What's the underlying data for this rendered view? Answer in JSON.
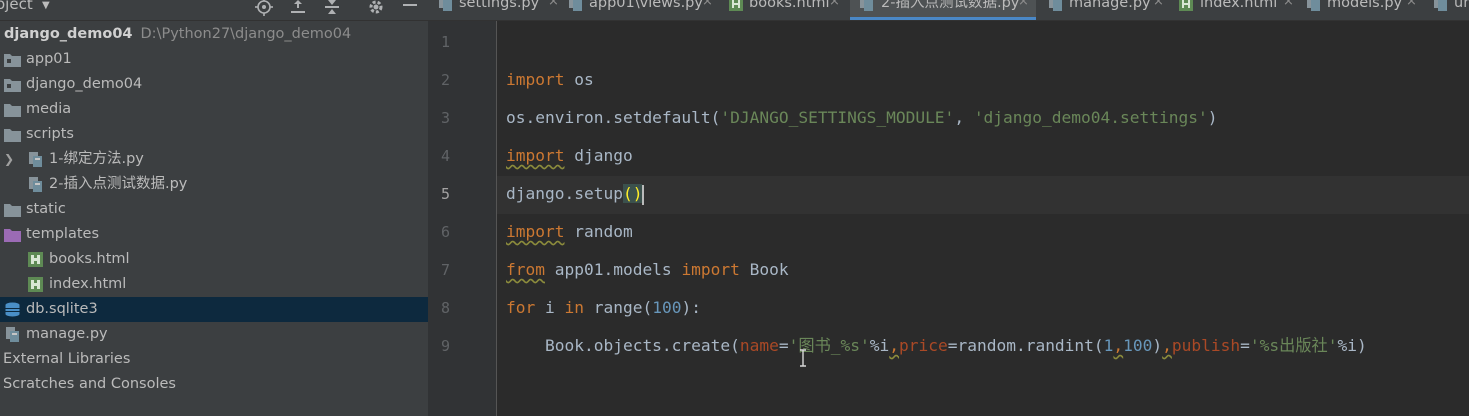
{
  "project_panel": {
    "title": "oject",
    "root": {
      "name": "django_demo04",
      "path": "D:\\Python27\\django_demo04"
    },
    "items": [
      {
        "label": "app01",
        "icon": "folder-icon"
      },
      {
        "label": "django_demo04",
        "icon": "folder-icon"
      },
      {
        "label": "media",
        "icon": "folder-icon"
      },
      {
        "label": "scripts",
        "icon": "folder-icon"
      },
      {
        "label": "1-绑定方法.py",
        "icon": "python-file-icon"
      },
      {
        "label": "2-插入点测试数据.py",
        "icon": "python-file-icon"
      },
      {
        "label": "static",
        "icon": "folder-icon"
      },
      {
        "label": "templates",
        "icon": "templates-folder-icon"
      },
      {
        "label": "books.html",
        "icon": "html-file-icon"
      },
      {
        "label": "index.html",
        "icon": "html-file-icon"
      },
      {
        "label": "db.sqlite3",
        "icon": "database-icon",
        "selected": true
      },
      {
        "label": "manage.py",
        "icon": "python-file-icon"
      },
      {
        "label": "External Libraries",
        "icon": ""
      },
      {
        "label": "Scratches and Consoles",
        "icon": ""
      }
    ]
  },
  "tabs": [
    {
      "label": "settings.py",
      "icon": "python-file-icon"
    },
    {
      "label": "app01\\views.py",
      "icon": "python-file-icon"
    },
    {
      "label": "books.html",
      "icon": "html-file-icon"
    },
    {
      "label": "2-插入点测试数据.py",
      "icon": "python-file-icon",
      "active": true
    },
    {
      "label": "manage.py",
      "icon": "python-file-icon"
    },
    {
      "label": "index.html",
      "icon": "html-file-icon"
    },
    {
      "label": "models.py",
      "icon": "python-file-icon"
    },
    {
      "label": "url",
      "icon": "python-file-icon"
    }
  ],
  "tab_close_glyph": "×",
  "editor": {
    "line_numbers": [
      "1",
      "2",
      "3",
      "4",
      "5",
      "6",
      "7",
      "8",
      "9"
    ],
    "current_line": 5,
    "code": {
      "l2_kw": "import",
      "l2_rest": " os",
      "l3_a": "os.environ.setdefault(",
      "l3_s1": "'DJANGO_SETTINGS_MODULE'",
      "l3_b": ", ",
      "l3_s2": "'django_demo04.settings'",
      "l3_c": ")",
      "l4_kw": "import",
      "l4_rest": " django",
      "l5_a": "django.setup",
      "l5_paren": "()",
      "l6_kw": "import",
      "l6_rest": " random",
      "l7_kw1": "from",
      "l7_mid": " app01.models ",
      "l7_kw2": "import",
      "l7_rest": " Book",
      "l8_kw1": "for",
      "l8_a": " i ",
      "l8_kw2": "in",
      "l8_b": " range(",
      "l8_num": "100",
      "l8_c": "):",
      "l9_indent": "    ",
      "l9_a": "Book.objects.create(",
      "l9_p1": "name",
      "l9_eq1": "=",
      "l9_s1": "'图书_%s'",
      "l9_b": "%i",
      "l9_c1": ",",
      "l9_p2": "price",
      "l9_eq2": "=random.randint(",
      "l9_n1": "1",
      "l9_c2": ",",
      "l9_n2": "100",
      "l9_d": ")",
      "l9_c3": ",",
      "l9_p3": "publish",
      "l9_eq3": "=",
      "l9_s2": "'%s出版社'",
      "l9_e": "%i)"
    }
  },
  "colors": {
    "editor_bg": "#2b2b2b",
    "panel_bg": "#3c3f41",
    "selection": "#0d293e",
    "keyword": "#cc7832",
    "string": "#6a8759",
    "number": "#6897bb",
    "param": "#aa4926",
    "tab_underline": "#4a88c7"
  }
}
